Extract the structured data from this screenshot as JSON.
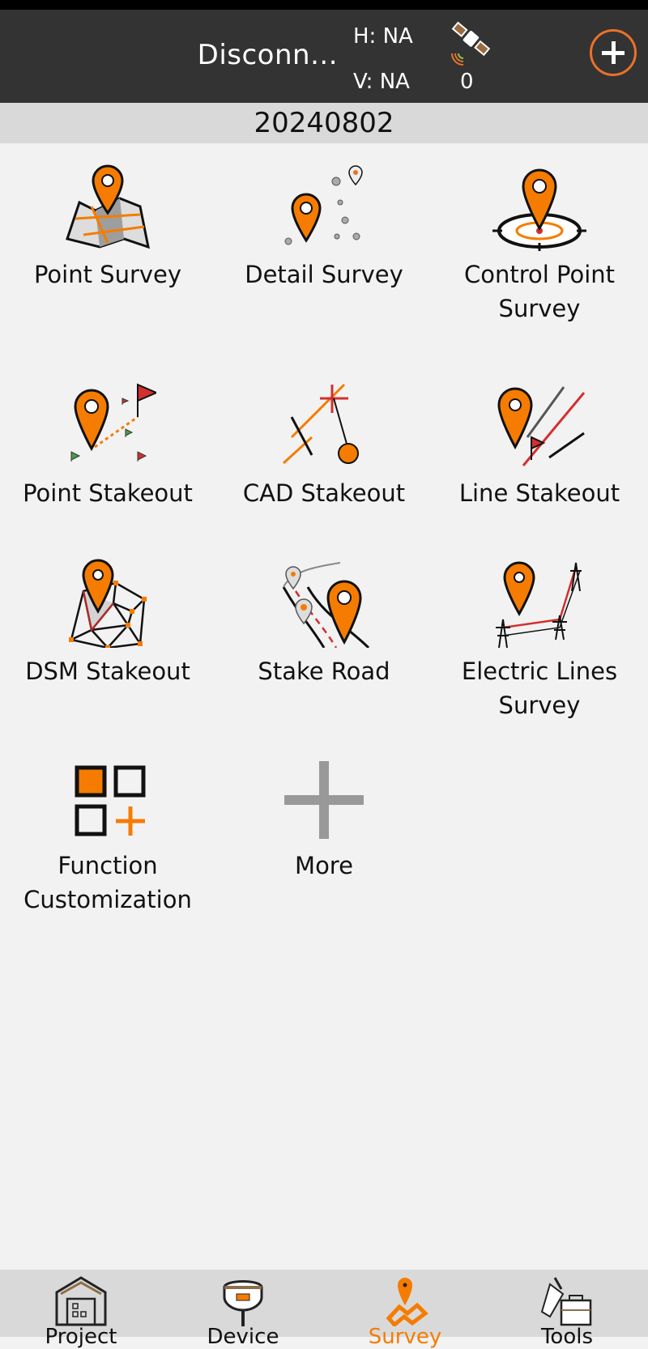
{
  "status_bar": {},
  "header": {
    "connection_status": "Disconn...",
    "h_precision": "H: NA",
    "v_precision": "V: NA",
    "satellite_count": "0",
    "add_button_icon": "plus-circle-icon"
  },
  "project_name": "20240802",
  "colors": {
    "accent": "#f57c00",
    "header_bg": "#333333",
    "tab_bg": "#d9d9d9"
  },
  "functions": [
    {
      "label": "Point Survey",
      "icon": "map-pin-icon"
    },
    {
      "label": "Detail Survey",
      "icon": "multi-pin-icon"
    },
    {
      "label": "Control Point Survey",
      "icon": "target-pin-icon"
    },
    {
      "label": "Point Stakeout",
      "icon": "pin-flags-icon"
    },
    {
      "label": "CAD Stakeout",
      "icon": "cad-crosshair-icon"
    },
    {
      "label": "Line Stakeout",
      "icon": "line-flag-icon"
    },
    {
      "label": "DSM Stakeout",
      "icon": "triangulation-mesh-icon"
    },
    {
      "label": "Stake Road",
      "icon": "road-pin-icon"
    },
    {
      "label": "Electric Lines Survey",
      "icon": "power-tower-icon"
    },
    {
      "label": "Function Customization",
      "icon": "grid-add-icon"
    },
    {
      "label": "More",
      "icon": "plus-icon"
    }
  ],
  "tabs": [
    {
      "label": "Project",
      "icon": "warehouse-icon",
      "active": false
    },
    {
      "label": "Device",
      "icon": "gnss-receiver-icon",
      "active": false
    },
    {
      "label": "Survey",
      "icon": "survey-pin-icon",
      "active": true
    },
    {
      "label": "Tools",
      "icon": "toolbox-icon",
      "active": false
    }
  ]
}
